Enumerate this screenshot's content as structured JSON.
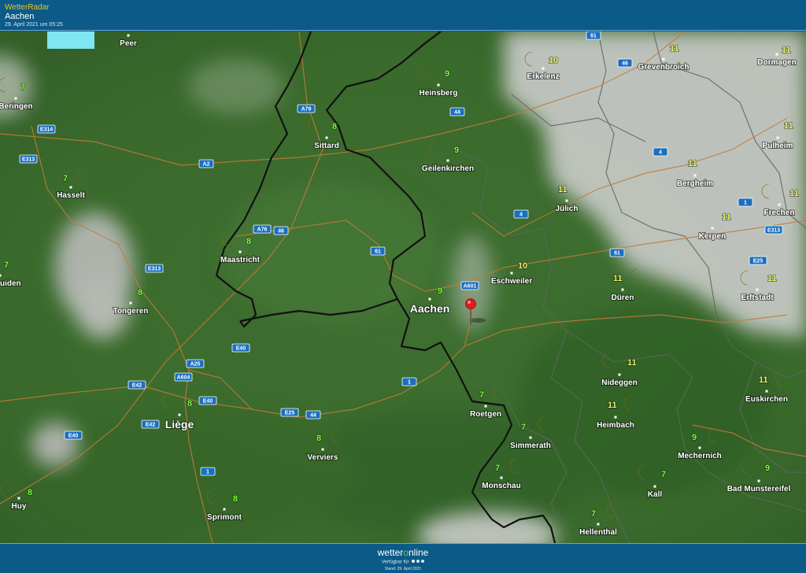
{
  "header": {
    "app_title": "WetterRadar",
    "place": "Aachen",
    "timestamp": "29. April 2021 um 05:25"
  },
  "footer": {
    "brand_pre": "wetter",
    "brand_o": "o",
    "brand_post": "nline",
    "availability": "Verfügbar für",
    "stand": "Stand: 29. April 2021"
  },
  "colors": {
    "header_bg": "#0b5a88",
    "app_title": "#f4c21f",
    "terrain": "#3f7232",
    "cloud": "#c9c9c9",
    "road_shield": "#1a6fc0",
    "temp_green": "#7dff3a",
    "temp_yellow": "#e9f06a",
    "moon": "#f5cf1c",
    "marker": "#e21b1b"
  },
  "map": {
    "weather_icon": "crescent-moon-icon",
    "location_marker": "red-pin-icon",
    "cities": [
      {
        "name": "Peer",
        "temp": "",
        "size": "s"
      },
      {
        "name": "Beringen",
        "temp": "7",
        "size": "s"
      },
      {
        "name": "Hasselt",
        "temp": "7",
        "size": "s"
      },
      {
        "name": "uiden",
        "temp": "7",
        "size": "s"
      },
      {
        "name": "Tongeren",
        "temp": "8",
        "size": "s"
      },
      {
        "name": "Sittard",
        "temp": "8",
        "size": "s"
      },
      {
        "name": "Maastricht",
        "temp": "8",
        "size": "s"
      },
      {
        "name": "Heinsberg",
        "temp": "9",
        "size": "s"
      },
      {
        "name": "Geilenkirchen",
        "temp": "9",
        "size": "s"
      },
      {
        "name": "Aachen",
        "temp": "9",
        "size": "l"
      },
      {
        "name": "Eschweiler",
        "temp": "10",
        "size": "s"
      },
      {
        "name": "Erkelenz",
        "temp": "10",
        "size": "s"
      },
      {
        "name": "Jülich",
        "temp": "11",
        "size": "s"
      },
      {
        "name": "Grevenbroich",
        "temp": "11",
        "size": "s"
      },
      {
        "name": "Dormagen",
        "temp": "11",
        "size": "s"
      },
      {
        "name": "Pulheim",
        "temp": "11",
        "size": "s"
      },
      {
        "name": "Bergheim",
        "temp": "11",
        "size": "s"
      },
      {
        "name": "Frechen",
        "temp": "11",
        "size": "s"
      },
      {
        "name": "Kerpen",
        "temp": "11",
        "size": "s"
      },
      {
        "name": "Düren",
        "temp": "11",
        "size": "s"
      },
      {
        "name": "Erftstadt",
        "temp": "11",
        "size": "s"
      },
      {
        "name": "Nideggen",
        "temp": "11",
        "size": "s"
      },
      {
        "name": "Heimbach",
        "temp": "11",
        "size": "s"
      },
      {
        "name": "Euskirchen",
        "temp": "11",
        "size": "s"
      },
      {
        "name": "Mechernich",
        "temp": "9",
        "size": "s"
      },
      {
        "name": "Bad Munstereifel",
        "temp": "9",
        "size": "s"
      },
      {
        "name": "Roetgen",
        "temp": "7",
        "size": "s"
      },
      {
        "name": "Simmerath",
        "temp": "7",
        "size": "s"
      },
      {
        "name": "Monschau",
        "temp": "7",
        "size": "s"
      },
      {
        "name": "Kall",
        "temp": "7",
        "size": "s"
      },
      {
        "name": "Hellenthal",
        "temp": "7",
        "size": "s"
      },
      {
        "name": "Liège",
        "temp": "8",
        "size": "l"
      },
      {
        "name": "Verviers",
        "temp": "8",
        "size": "s"
      },
      {
        "name": "Sprimont",
        "temp": "8",
        "size": "s"
      },
      {
        "name": "Huy",
        "temp": "8",
        "size": "s"
      }
    ],
    "road_labels": [
      "61",
      "46",
      "E314",
      "E313",
      "A2",
      "A79",
      "A76",
      "46",
      "61",
      "44",
      "4",
      "4",
      "1",
      "61",
      "E313",
      "E25",
      "A601",
      "E313",
      "E40",
      "A25",
      "A604",
      "E42",
      "E40",
      "E42",
      "E40",
      "E25",
      "44",
      "1",
      "1"
    ]
  }
}
